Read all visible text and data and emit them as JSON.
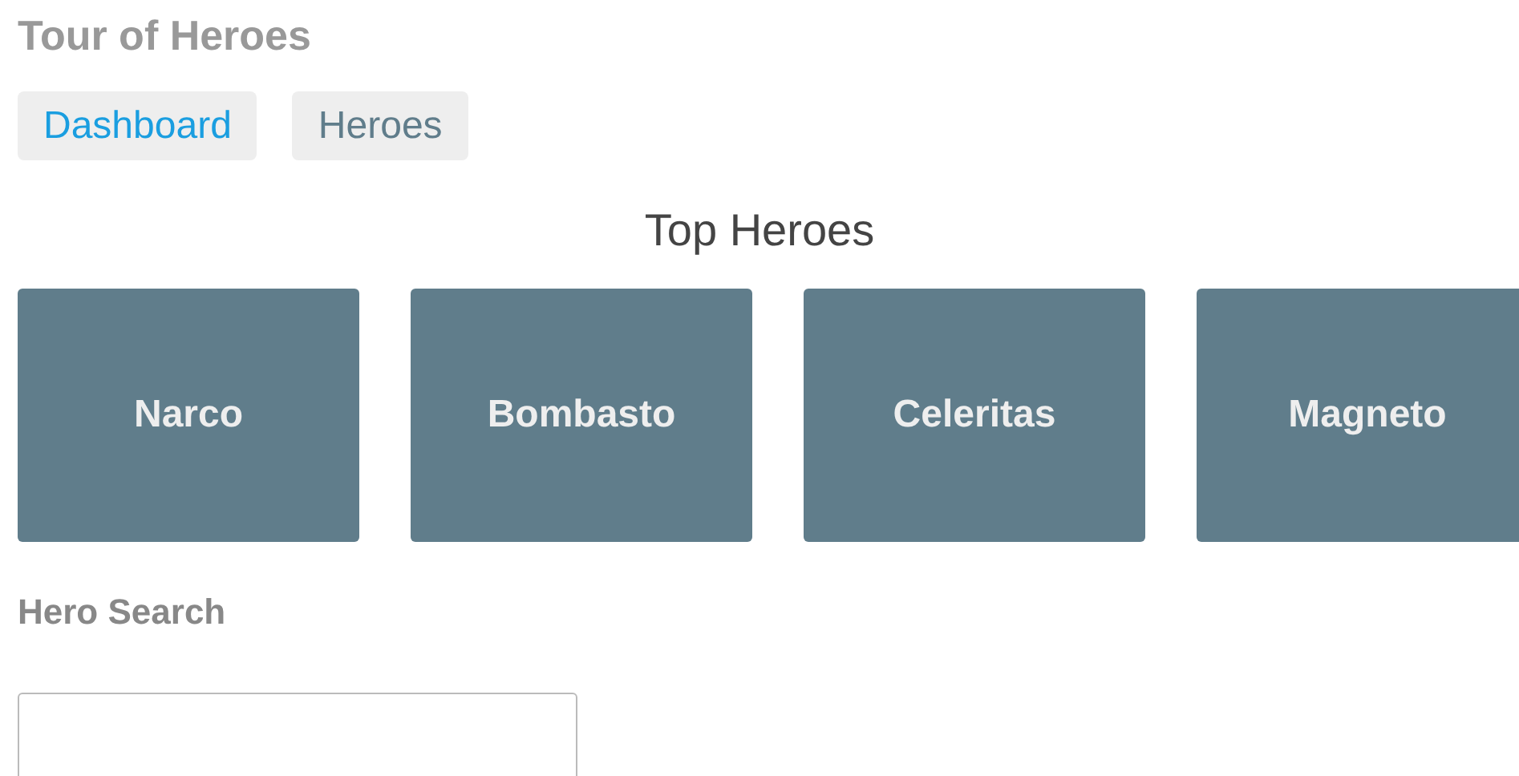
{
  "title": "Tour of Heroes",
  "nav": [
    {
      "label": "Dashboard",
      "selected": true
    },
    {
      "label": "Heroes",
      "selected": false
    }
  ],
  "dashboard": {
    "heading": "Top Heroes",
    "heroes": [
      "Narco",
      "Bombasto",
      "Celeritas",
      "Magneto"
    ]
  },
  "search": {
    "heading": "Hero Search"
  }
}
